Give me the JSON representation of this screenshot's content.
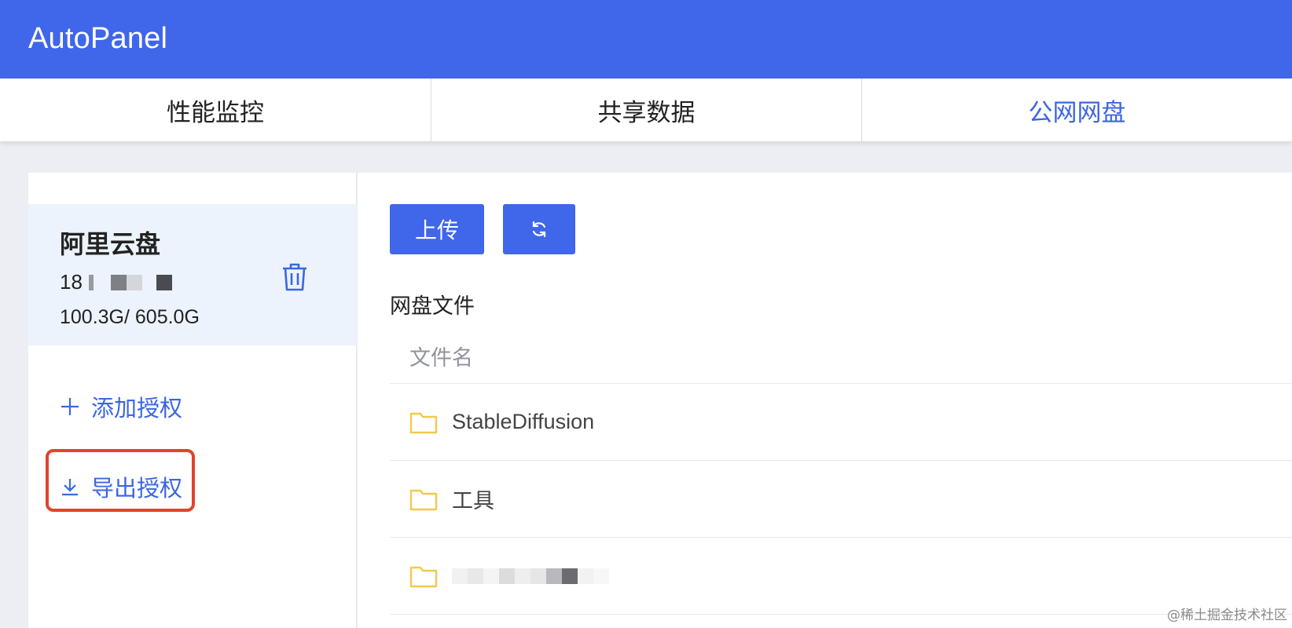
{
  "header": {
    "title": "AutoPanel",
    "bg_color": "#4066ea"
  },
  "tabs": [
    {
      "label": "性能监控",
      "active": false
    },
    {
      "label": "共享数据",
      "active": false
    },
    {
      "label": "公网网盘",
      "active": true
    }
  ],
  "sidebar": {
    "account": {
      "name": "阿里云盘",
      "id_prefix": "18",
      "quota": "100.3G/ 605.0G",
      "delete_icon": "trash-icon"
    },
    "actions": {
      "add_label": "添加授权",
      "add_icon": "plus-icon",
      "export_label": "导出授权",
      "export_icon": "download-icon"
    }
  },
  "toolbar": {
    "upload_label": "上传",
    "refresh_icon": "refresh-icon"
  },
  "files": {
    "section_title": "网盘文件",
    "column_name": "文件名",
    "rows": [
      {
        "name": "StableDiffusion",
        "icon": "folder-icon"
      },
      {
        "name": "工具",
        "icon": "folder-icon"
      },
      {
        "name": "",
        "icon": "folder-icon",
        "obscured": true
      }
    ]
  },
  "watermark": "@稀土掘金技术社区",
  "colors": {
    "accent": "#4066ea",
    "highlight": "#e2432b",
    "folder": "#f2c94c"
  }
}
